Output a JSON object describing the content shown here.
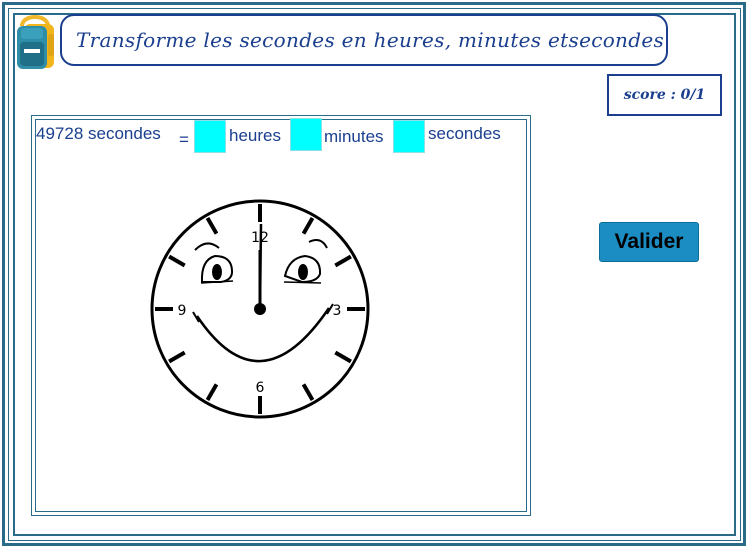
{
  "header": {
    "title": "Transforme les secondes en heures, minutes etsecondes"
  },
  "score": {
    "label": "score : 0/1"
  },
  "question": {
    "prefix": "49728 secondes",
    "equals": "=",
    "hours_label": "heures",
    "minutes_label": "minutes",
    "seconds_label": "secondes",
    "hours_value": "",
    "minutes_value": "",
    "seconds_value": ""
  },
  "clock": {
    "numerals": [
      "12",
      "3",
      "6",
      "9"
    ],
    "time_shown": "12:00"
  },
  "actions": {
    "validate_label": "Valider"
  },
  "colors": {
    "frame": "#2a6b8a",
    "text": "#1b3f8f",
    "answer_fill": "#00ffff",
    "button": "#1c8dc2"
  },
  "icons": {
    "app_logo": "school-backpack-icon"
  }
}
